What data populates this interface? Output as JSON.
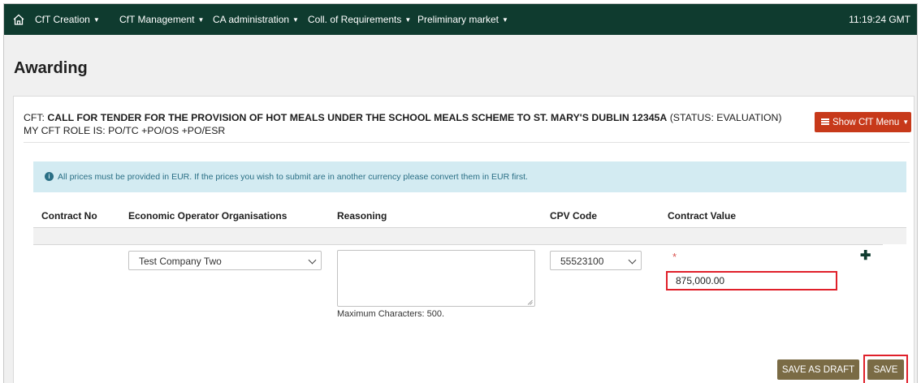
{
  "nav": {
    "items": [
      {
        "label": "CfT Creation"
      },
      {
        "label": "CfT Management"
      },
      {
        "label": "CA administration"
      },
      {
        "label": "Coll. of Requirements"
      },
      {
        "label": "Preliminary market"
      }
    ],
    "clock": "11:19:24 GMT"
  },
  "page": {
    "title": "Awarding"
  },
  "cft": {
    "prefix": "CFT: ",
    "name": "CALL FOR TENDER FOR THE PROVISION OF HOT MEALS UNDER THE SCHOOL MEALS SCHEME TO ST. MARY'S DUBLIN 12345A",
    "status": " (STATUS: EVALUATION) MY CFT ROLE IS: PO/TC +PO/OS +PO/ESR",
    "menu_button": "Show CfT Menu"
  },
  "info": {
    "text": "All prices must be provided in EUR. If the prices you wish to submit are in another currency please convert them in EUR first."
  },
  "table": {
    "headers": [
      "Contract No",
      "Economic Operator Organisations",
      "Reasoning",
      "CPV Code",
      "Contract Value"
    ],
    "row": {
      "operator": "Test Company Two",
      "reasoning": "",
      "max_chars": "Maximum Characters: 500.",
      "cpv": "55523100",
      "required_mark": "*",
      "value": "875,000.00"
    }
  },
  "actions": {
    "save_draft": "SAVE AS DRAFT",
    "save": "SAVE"
  },
  "colors": {
    "nav_bg": "#0f3b2f",
    "menu_btn": "#c7391a",
    "action_btn": "#7a6b45",
    "highlight": "#e0202a"
  }
}
